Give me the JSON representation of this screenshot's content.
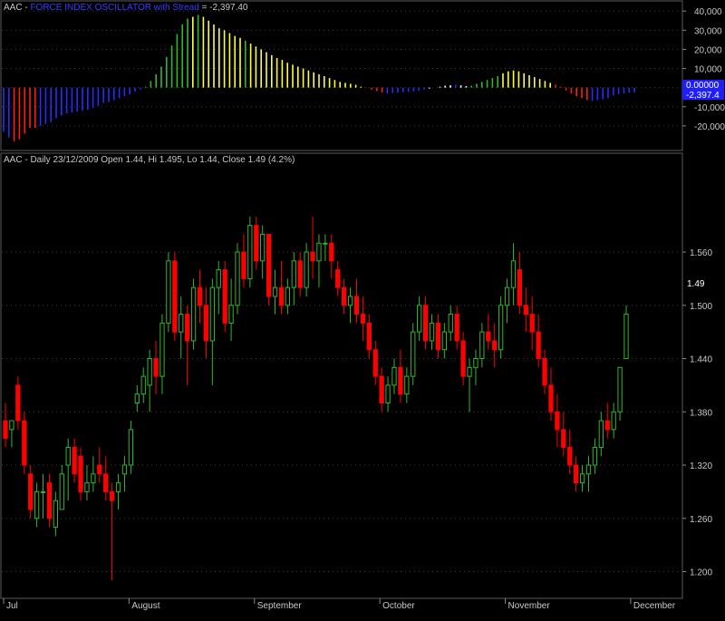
{
  "colors": {
    "background": "#000000",
    "grid": "#3a3a3a",
    "axis_text": "#c8c8c8",
    "up_candle": "#2fb82f",
    "down_candle": "#ff0000",
    "force_blue": "#2a2aff",
    "force_red": "#ff1a1a",
    "force_green": "#2fb82f",
    "force_yellow": "#ffff33",
    "force_white": "#ffffff",
    "title_blue": "#3a3aff",
    "badge_blue": "#1e1eff"
  },
  "indicator_panel": {
    "title_prefix": "AAC - ",
    "title_name": "FORCE INDEX OSCILLATOR with Stread",
    "title_value": " = -2,397.40",
    "zero_badge": "0.00000",
    "value_badge": "-2,397.4"
  },
  "price_panel": {
    "title": "AAC - Daily 23/12/2009 Open 1.44, Hi 1.495, Lo 1.44, Close 1.49 (4.2%)",
    "last_price_label": "1.49"
  },
  "chart_data": [
    {
      "type": "bar",
      "title": "AAC - FORCE INDEX OSCILLATOR with Stread = -2,397.40",
      "ylim": [
        -30000,
        42000
      ],
      "y_ticks": [
        "40,000",
        "30,000",
        "20,000",
        "10,000",
        "0",
        "-10,000",
        "-20,000"
      ],
      "y_tick_values": [
        40000,
        30000,
        20000,
        10000,
        0,
        -10000,
        -20000
      ],
      "last_value": -2397.4,
      "values": [
        -23000,
        -26000,
        -28000,
        -27000,
        -24000,
        -21000,
        -21000,
        -20000,
        -19000,
        -18000,
        -16000,
        -14500,
        -13500,
        -13000,
        -12500,
        -12000,
        -11500,
        -10500,
        -9500,
        -8000,
        -7500,
        -6500,
        -5500,
        -4500,
        -3500,
        -2000,
        -1000,
        500,
        3500,
        7000,
        11000,
        16000,
        22000,
        28000,
        33000,
        36000,
        37000,
        38000,
        37000,
        35000,
        33000,
        31000,
        30000,
        28500,
        27000,
        26000,
        24500,
        23000,
        21500,
        20000,
        18500,
        17000,
        15500,
        14500,
        13000,
        12000,
        11000,
        10000,
        9000,
        8000,
        7000,
        6000,
        5000,
        4000,
        3000,
        2500,
        2000,
        1500,
        500,
        -200,
        -1000,
        -1800,
        -2500,
        -3000,
        -2800,
        -2600,
        -2400,
        -2200,
        -2000,
        -1500,
        -1000,
        -500,
        0,
        500,
        1000,
        1200,
        1500,
        1200,
        800,
        1000,
        2000,
        3000,
        4000,
        5000,
        6000,
        7500,
        8500,
        9000,
        8500,
        7500,
        6500,
        5500,
        4500,
        3500,
        2500,
        1500,
        500,
        -1500,
        -3000,
        -4500,
        -5500,
        -6500,
        -7000,
        -6500,
        -6000,
        -5500,
        -4000,
        -3500,
        -3000,
        -2600,
        -2400
      ],
      "colors": [
        "blue",
        "blue",
        "red",
        "red",
        "red",
        "red",
        "red",
        "blue",
        "blue",
        "blue",
        "blue",
        "blue",
        "blue",
        "blue",
        "blue",
        "blue",
        "blue",
        "blue",
        "blue",
        "blue",
        "blue",
        "blue",
        "blue",
        "blue",
        "blue",
        "blue",
        "blue",
        "green",
        "green",
        "green",
        "green",
        "green",
        "green",
        "green",
        "green",
        "green",
        "yellow",
        "green",
        "yellow",
        "yellow",
        "yellow",
        "yellow",
        "yellow",
        "yellow",
        "yellow",
        "yellow",
        "green",
        "yellow",
        "yellow",
        "yellow",
        "yellow",
        "yellow",
        "yellow",
        "yellow",
        "yellow",
        "yellow",
        "yellow",
        "yellow",
        "yellow",
        "yellow",
        "yellow",
        "yellow",
        "yellow",
        "yellow",
        "yellow",
        "yellow",
        "yellow",
        "yellow",
        "yellow",
        "red",
        "red",
        "red",
        "red",
        "blue",
        "blue",
        "blue",
        "blue",
        "blue",
        "blue",
        "blue",
        "blue",
        "white",
        "white",
        "white",
        "white",
        "white",
        "blue",
        "white",
        "white",
        "green",
        "green",
        "green",
        "green",
        "green",
        "green",
        "yellow",
        "yellow",
        "yellow",
        "yellow",
        "yellow",
        "yellow",
        "yellow",
        "yellow",
        "yellow",
        "yellow",
        "red",
        "red",
        "red",
        "red",
        "red",
        "red",
        "red",
        "blue",
        "blue",
        "blue",
        "blue",
        "blue",
        "blue",
        "blue",
        "blue"
      ]
    },
    {
      "type": "candlestick",
      "title": "AAC - Daily 23/12/2009 Open 1.44, Hi 1.495, Lo 1.44, Close 1.49 (4.2%)",
      "ylim": [
        1.175,
        1.655
      ],
      "y_ticks": [
        "1.560",
        "1.500",
        "1.440",
        "1.380",
        "1.320",
        "1.260",
        "1.200"
      ],
      "y_tick_values": [
        1.56,
        1.5,
        1.44,
        1.38,
        1.32,
        1.26,
        1.2
      ],
      "x_labels": [
        "Jul",
        "August",
        "September",
        "October",
        "November",
        "December"
      ],
      "x_label_bar_index": [
        0,
        20,
        40,
        60,
        80,
        100
      ],
      "ohlc": [
        [
          1.37,
          1.39,
          1.34,
          1.35
        ],
        [
          1.36,
          1.37,
          1.34,
          1.37
        ],
        [
          1.41,
          1.42,
          1.36,
          1.37
        ],
        [
          1.37,
          1.38,
          1.31,
          1.32
        ],
        [
          1.31,
          1.32,
          1.26,
          1.27
        ],
        [
          1.26,
          1.3,
          1.25,
          1.29
        ],
        [
          1.29,
          1.31,
          1.26,
          1.29
        ],
        [
          1.3,
          1.31,
          1.25,
          1.26
        ],
        [
          1.25,
          1.29,
          1.24,
          1.28
        ],
        [
          1.27,
          1.32,
          1.27,
          1.31
        ],
        [
          1.32,
          1.35,
          1.28,
          1.34
        ],
        [
          1.34,
          1.35,
          1.3,
          1.31
        ],
        [
          1.33,
          1.34,
          1.28,
          1.29
        ],
        [
          1.29,
          1.32,
          1.28,
          1.3
        ],
        [
          1.3,
          1.33,
          1.29,
          1.31
        ],
        [
          1.32,
          1.34,
          1.3,
          1.31
        ],
        [
          1.31,
          1.33,
          1.28,
          1.29
        ],
        [
          1.29,
          1.3,
          1.19,
          1.28
        ],
        [
          1.29,
          1.31,
          1.27,
          1.3
        ],
        [
          1.31,
          1.33,
          1.29,
          1.32
        ],
        [
          1.32,
          1.37,
          1.31,
          1.36
        ],
        [
          1.39,
          1.41,
          1.38,
          1.4
        ],
        [
          1.4,
          1.43,
          1.39,
          1.42
        ],
        [
          1.41,
          1.45,
          1.38,
          1.44
        ],
        [
          1.44,
          1.46,
          1.4,
          1.42
        ],
        [
          1.42,
          1.49,
          1.4,
          1.48
        ],
        [
          1.48,
          1.56,
          1.47,
          1.55
        ],
        [
          1.55,
          1.56,
          1.46,
          1.47
        ],
        [
          1.47,
          1.51,
          1.44,
          1.49
        ],
        [
          1.49,
          1.5,
          1.41,
          1.46
        ],
        [
          1.46,
          1.53,
          1.45,
          1.52
        ],
        [
          1.52,
          1.54,
          1.48,
          1.5
        ],
        [
          1.5,
          1.52,
          1.44,
          1.46
        ],
        [
          1.46,
          1.53,
          1.41,
          1.52
        ],
        [
          1.52,
          1.55,
          1.49,
          1.54
        ],
        [
          1.54,
          1.55,
          1.47,
          1.48
        ],
        [
          1.48,
          1.53,
          1.46,
          1.5
        ],
        [
          1.5,
          1.57,
          1.49,
          1.56
        ],
        [
          1.56,
          1.58,
          1.52,
          1.53
        ],
        [
          1.53,
          1.6,
          1.52,
          1.59
        ],
        [
          1.59,
          1.6,
          1.54,
          1.55
        ],
        [
          1.55,
          1.59,
          1.53,
          1.58
        ],
        [
          1.58,
          1.58,
          1.5,
          1.51
        ],
        [
          1.51,
          1.54,
          1.49,
          1.52
        ],
        [
          1.52,
          1.55,
          1.49,
          1.5
        ],
        [
          1.5,
          1.53,
          1.49,
          1.52
        ],
        [
          1.52,
          1.56,
          1.5,
          1.55
        ],
        [
          1.55,
          1.56,
          1.51,
          1.52
        ],
        [
          1.52,
          1.57,
          1.51,
          1.56
        ],
        [
          1.56,
          1.6,
          1.53,
          1.55
        ],
        [
          1.55,
          1.58,
          1.52,
          1.57
        ],
        [
          1.57,
          1.58,
          1.55,
          1.57
        ],
        [
          1.57,
          1.58,
          1.53,
          1.55
        ],
        [
          1.54,
          1.55,
          1.51,
          1.52
        ],
        [
          1.52,
          1.53,
          1.49,
          1.5
        ],
        [
          1.5,
          1.52,
          1.48,
          1.51
        ],
        [
          1.51,
          1.53,
          1.48,
          1.49
        ],
        [
          1.49,
          1.51,
          1.46,
          1.48
        ],
        [
          1.48,
          1.49,
          1.44,
          1.45
        ],
        [
          1.45,
          1.46,
          1.41,
          1.42
        ],
        [
          1.42,
          1.43,
          1.38,
          1.39
        ],
        [
          1.39,
          1.42,
          1.38,
          1.41
        ],
        [
          1.41,
          1.44,
          1.4,
          1.43
        ],
        [
          1.43,
          1.45,
          1.39,
          1.4
        ],
        [
          1.4,
          1.43,
          1.39,
          1.42
        ],
        [
          1.42,
          1.48,
          1.41,
          1.47
        ],
        [
          1.47,
          1.51,
          1.46,
          1.5
        ],
        [
          1.5,
          1.51,
          1.45,
          1.46
        ],
        [
          1.46,
          1.49,
          1.45,
          1.48
        ],
        [
          1.48,
          1.49,
          1.44,
          1.45
        ],
        [
          1.45,
          1.48,
          1.44,
          1.47
        ],
        [
          1.47,
          1.5,
          1.46,
          1.49
        ],
        [
          1.49,
          1.5,
          1.45,
          1.46
        ],
        [
          1.46,
          1.47,
          1.41,
          1.42
        ],
        [
          1.42,
          1.44,
          1.38,
          1.43
        ],
        [
          1.43,
          1.45,
          1.41,
          1.44
        ],
        [
          1.44,
          1.48,
          1.43,
          1.47
        ],
        [
          1.47,
          1.49,
          1.45,
          1.46
        ],
        [
          1.46,
          1.48,
          1.43,
          1.45
        ],
        [
          1.45,
          1.51,
          1.44,
          1.5
        ],
        [
          1.5,
          1.53,
          1.48,
          1.52
        ],
        [
          1.52,
          1.57,
          1.5,
          1.55
        ],
        [
          1.54,
          1.56,
          1.49,
          1.5
        ],
        [
          1.5,
          1.52,
          1.47,
          1.49
        ],
        [
          1.49,
          1.51,
          1.45,
          1.47
        ],
        [
          1.47,
          1.49,
          1.43,
          1.44
        ],
        [
          1.44,
          1.45,
          1.4,
          1.41
        ],
        [
          1.41,
          1.43,
          1.37,
          1.38
        ],
        [
          1.38,
          1.4,
          1.34,
          1.36
        ],
        [
          1.36,
          1.38,
          1.33,
          1.34
        ],
        [
          1.34,
          1.36,
          1.31,
          1.32
        ],
        [
          1.32,
          1.33,
          1.29,
          1.3
        ],
        [
          1.3,
          1.32,
          1.29,
          1.31
        ],
        [
          1.31,
          1.33,
          1.29,
          1.32
        ],
        [
          1.32,
          1.35,
          1.31,
          1.34
        ],
        [
          1.34,
          1.38,
          1.33,
          1.37
        ],
        [
          1.37,
          1.39,
          1.35,
          1.36
        ],
        [
          1.36,
          1.39,
          1.35,
          1.38
        ],
        [
          1.38,
          1.43,
          1.37,
          1.43
        ],
        [
          1.44,
          1.5,
          1.44,
          1.49
        ]
      ],
      "last_value": 1.49
    }
  ]
}
